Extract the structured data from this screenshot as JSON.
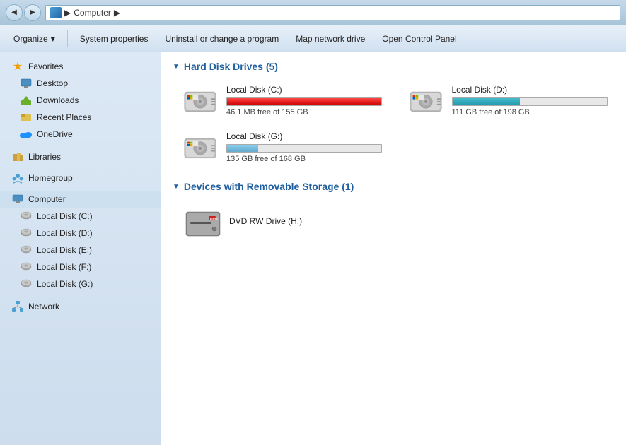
{
  "titlebar": {
    "address_label": "Computer",
    "chevron": "▶"
  },
  "toolbar": {
    "organize_label": "Organize",
    "system_properties_label": "System properties",
    "uninstall_label": "Uninstall or change a program",
    "map_network_label": "Map network drive",
    "open_control_label": "Open Control Panel"
  },
  "sidebar": {
    "favorites_label": "Favorites",
    "desktop_label": "Desktop",
    "downloads_label": "Downloads",
    "recent_places_label": "Recent Places",
    "onedrive_label": "OneDrive",
    "libraries_label": "Libraries",
    "homegroup_label": "Homegroup",
    "computer_label": "Computer",
    "network_label": "Network",
    "computer_drives": [
      "Local Disk (C:)",
      "Local Disk (D:)",
      "Local Disk (E:)",
      "Local Disk (F:)",
      "Local Disk (G:)"
    ]
  },
  "hard_disk_section": {
    "title": "Hard Disk Drives (5)",
    "drives": [
      {
        "name": "Local Disk (C:)",
        "free": "46.1 MB free of 155 GB",
        "bar_pct": 99.97,
        "bar_class": "bar-red"
      },
      {
        "name": "Local Disk (D:)",
        "free": "111 GB free of 198 GB",
        "bar_pct": 44,
        "bar_class": "bar-teal"
      },
      {
        "name": "Local Disk (G:)",
        "free": "135 GB free of 168 GB",
        "bar_pct": 20,
        "bar_class": "bar-blue-light"
      }
    ]
  },
  "removable_section": {
    "title": "Devices with Removable Storage (1)",
    "devices": [
      {
        "name": "DVD RW Drive (H:)"
      }
    ]
  },
  "colors": {
    "section_title": "#2060a0",
    "sidebar_bg": "#dce8f5"
  }
}
